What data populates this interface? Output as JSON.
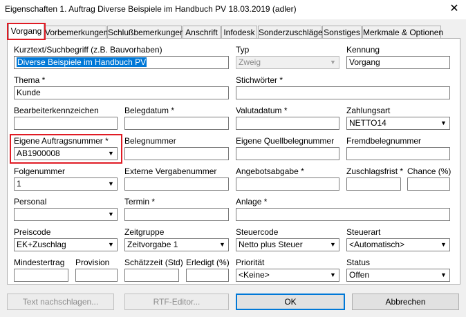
{
  "window": {
    "title": "Eigenschaften 1. Auftrag Diverse Beispiele im Handbuch PV 18.03.2019 (adler)",
    "close_glyph": "✕"
  },
  "tabs": [
    "Vorgang",
    "Vorbemerkungen",
    "Schlußbemerkungen",
    "Anschrift",
    "Infodesk",
    "Sonderzuschläge",
    "Sonstiges",
    "Merkmale & Optionen"
  ],
  "fields": {
    "kurztext": {
      "label": "Kurztext/Suchbegriff (z.B. Bauvorhaben)",
      "value": "Diverse Beispiele im Handbuch PV"
    },
    "typ": {
      "label": "Typ",
      "value": "Zweig"
    },
    "kennung": {
      "label": "Kennung",
      "value": "Vorgang"
    },
    "thema": {
      "label": "Thema *",
      "value": "Kunde"
    },
    "stichwoerter": {
      "label": "Stichwörter *",
      "value": ""
    },
    "bearbeiter": {
      "label": "Bearbeiterkennzeichen",
      "value": ""
    },
    "belegdatum": {
      "label": "Belegdatum *",
      "value": ""
    },
    "valutadatum": {
      "label": "Valutadatum *",
      "value": ""
    },
    "zahlungsart": {
      "label": "Zahlungsart",
      "value": "NETTO14"
    },
    "auftragsnummer": {
      "label": "Eigene Auftragsnummer *",
      "value": "AB1900008"
    },
    "belegnummer": {
      "label": "Belegnummer",
      "value": ""
    },
    "quellbelegnummer": {
      "label": "Eigene Quellbelegnummer",
      "value": ""
    },
    "fremdbelegnummer": {
      "label": "Fremdbelegnummer",
      "value": ""
    },
    "folgenummer": {
      "label": "Folgenummer",
      "value": "1"
    },
    "ext_vergabenummer": {
      "label": "Externe Vergabenummer",
      "value": ""
    },
    "angebotsabgabe": {
      "label": "Angebotsabgabe *",
      "value": ""
    },
    "zuschlagsfrist": {
      "label": "Zuschlagsfrist *",
      "value": ""
    },
    "chance": {
      "label": "Chance (%)",
      "value": ""
    },
    "personal": {
      "label": "Personal",
      "value": ""
    },
    "termin": {
      "label": "Termin *",
      "value": ""
    },
    "anlage": {
      "label": "Anlage *",
      "value": ""
    },
    "preiscode": {
      "label": "Preiscode",
      "value": "EK+Zuschlag"
    },
    "zeitgruppe": {
      "label": "Zeitgruppe",
      "value": "Zeitvorgabe 1"
    },
    "steuercode": {
      "label": "Steuercode",
      "value": "Netto plus Steuer"
    },
    "steuerart": {
      "label": "Steuerart",
      "value": "<Automatisch>"
    },
    "mindestertrag": {
      "label": "Mindestertrag",
      "value": ""
    },
    "provision": {
      "label": "Provision",
      "value": ""
    },
    "schaetzzeit": {
      "label": "Schätzzeit (Std)",
      "value": ""
    },
    "erledigt": {
      "label": "Erledigt (%)",
      "value": ""
    },
    "prioritaet": {
      "label": "Priorität",
      "value": "<Keine>"
    },
    "status": {
      "label": "Status",
      "value": "Offen"
    }
  },
  "buttons": {
    "text_lookup": "Text nachschlagen...",
    "rtf_editor": "RTF-Editor...",
    "ok": "OK",
    "cancel": "Abbrechen"
  },
  "dropdown_glyph": "▼",
  "colors": {
    "highlight": "#e01b24",
    "selection": "#0078d7"
  }
}
